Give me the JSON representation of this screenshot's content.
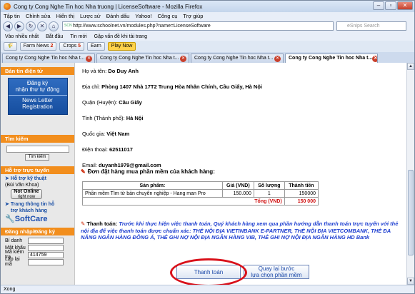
{
  "window": {
    "title": "Cong ty Cong Nghe Tin hoc Nha truong | LicenseSoftware - Mozilla Firefox"
  },
  "menu": [
    "Tập tin",
    "Chỉnh sửa",
    "Hiển thị",
    "Lược sử",
    "Đánh dấu",
    "Yahoo!",
    "Công cụ",
    "Trợ giúp"
  ],
  "nav": {
    "url": "http://www.schoolnet.vn/modules.php?name=LicenseSoftware",
    "url_badge": "SCN",
    "search_placeholder": "eSnips Search"
  },
  "bookmarks": [
    "Vào nhiều nhất",
    "Bắt đầu",
    "Tin mới",
    "Gặp vấn đề khi tải trang"
  ],
  "toolbar": {
    "farm": "Farm News",
    "crops": "Crops",
    "earn": "Earn",
    "play": "Play Now",
    "badge1": "2",
    "badge2": "5"
  },
  "tabs": [
    {
      "label": "Cong ty Cong Nghe Tin hoc Nha t..."
    },
    {
      "label": "Cong ty Cong Nghe Tin hoc Nha t..."
    },
    {
      "label": "Cong ty Cong Nghe Tin hoc Nha t..."
    },
    {
      "label": "Cong ty Cong Nghe Tin hoc Nha t..."
    }
  ],
  "sidebar": {
    "sell_title": "Bán tin điện tử",
    "reg_l1": "Đăng ký",
    "reg_l2": "nhận thư tự động",
    "reg_nl1": "News Letter",
    "reg_nl2": "Registration",
    "search_title": "Tìm kiếm",
    "search_btn": "Tìm kiếm",
    "support_title": "Hỗ trợ trực tuyến",
    "tech": "Hỗ trợ kỹ thuật",
    "tech_name": "(Bùi Văn Khoa)",
    "online_l1": "Not Online",
    "online_l2": "right now",
    "info1": "Trang thông tin hỗ",
    "info2": "trợ khách hàng",
    "softcare": "SoftCare",
    "login_title": "Đăng nhập/Đăng ký",
    "login_rows": [
      {
        "label": "Bí danh",
        "value": ""
      },
      {
        "label": "Mật khẩu",
        "value": ""
      },
      {
        "label": "Mã kiểm tra",
        "value": "414759"
      },
      {
        "label": "Lặp lại mã",
        "value": ""
      }
    ]
  },
  "customer": [
    {
      "label": "Họ và tên:",
      "value": "Do Duy Anh"
    },
    {
      "label": "Địa chỉ:",
      "value": "Phòng 1407 Nhà 17T2 Trung Hòa Nhân Chính, Cầu Giấy, Hà Nội"
    },
    {
      "label": "Quận (Huyện):",
      "value": "Cầu Giấy"
    },
    {
      "label": "Tỉnh (Thành phố):",
      "value": "Hà Nội"
    },
    {
      "label": "Quốc gia:",
      "value": "Việt Nam"
    },
    {
      "label": "Điện thoại:",
      "value": "62511017"
    },
    {
      "label": "Email:",
      "value": "duyanh1979@gmail.com"
    }
  ],
  "order": {
    "heading": "Đơn đặt hàng mua phần mềm của khách hàng:",
    "headers": [
      "Sản phẩm:",
      "Giá (VND)",
      "Số lượng",
      "Thành tiền"
    ],
    "row": {
      "product": "Phần mềm Tìm từ bản chuyên nghiệp - Hang man Pro",
      "price": "150.000",
      "qty": "1",
      "total": "150000"
    },
    "total_label": "Tổng (VND)",
    "total_value": "150 000"
  },
  "payment": {
    "label": "Thanh toán:",
    "message": "Trước khi thực hiện việc thanh toán, Quý khách hàng xem qua phần hướng dẫn thanh toán trực tuyến với thẻ nội địa để việc thanh toán được chuẩn xác: THẺ NỘI ĐỊA VIETINBANK E-PARTNER, THẺ NỘI ĐỊA VIETCOMBANK, THẺ ĐA NĂNG NGÂN HÀNG ĐÔNG Á, THẺ GHI NỢ NỘI ĐỊA NGÂN HÀNG VIB, THẺ GHI NỢ NỘI ĐỊA NGÂN HÀNG HD Bank",
    "pay_btn": "Thanh toán",
    "back_l1": "Quay lại bước",
    "back_l2": "lựa chọn phần mềm"
  },
  "status": "Xong",
  "colors": {
    "orange": "#f28e1d",
    "link_blue": "#1d3ed0",
    "red": "#d01010",
    "highlight": "#d9111a"
  }
}
